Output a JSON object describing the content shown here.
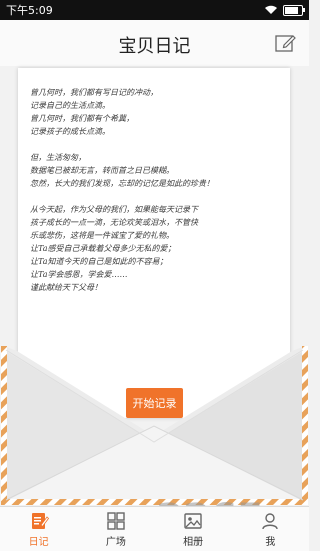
{
  "status_bar": {
    "time": "下午5:09"
  },
  "header": {
    "title": "宝贝日记"
  },
  "letter": {
    "paragraphs": [
      [
        "曾几何时，我们都有写日记的冲动，",
        "记录自己的生活点滴。",
        "曾几何时，我们都有个希冀，",
        "记录孩子的成长点滴。"
      ],
      [
        "但，生活匆匆，",
        "数据笔已被却无言，转而首之日已模糊。",
        "忽然，长大的我们发现，忘却的记忆是如此的珍贵！"
      ],
      [
        "从今天起，作为父母的我们，如果能每天记录下",
        "孩子成长的一点一滴，无论欢笑或泪水，不管快",
        "乐或悲伤，这将是一件诚宝了爱的礼物。",
        "让Ta感受自己承载着父母多少无私的爱；",
        "让Ta知道今天的自己是如此的不容易；",
        "让Ta学会感恩，学会爱……",
        "谨此献给天下父母！"
      ]
    ]
  },
  "start_button": {
    "label": "开始记录"
  },
  "tabs": [
    {
      "label": "日记",
      "icon": "diary-icon",
      "active": true
    },
    {
      "label": "广场",
      "icon": "grid-icon",
      "active": false
    },
    {
      "label": "相册",
      "icon": "album-icon",
      "active": false
    },
    {
      "label": "我",
      "icon": "person-icon",
      "active": false
    }
  ],
  "watermark": {
    "number": "2265",
    "text": "手游网",
    "url": ".com"
  },
  "colors": {
    "accent": "#f0732a",
    "envelope_border": "#e8a25a"
  },
  "battery_level": 0.8
}
